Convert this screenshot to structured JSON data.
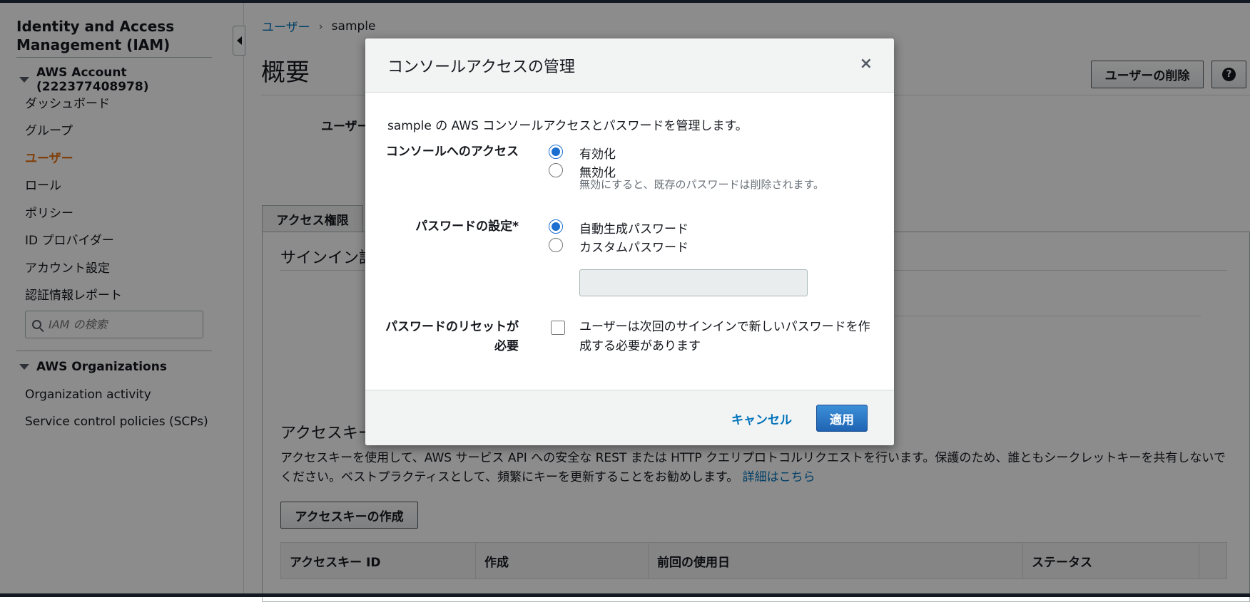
{
  "sidebar": {
    "title": "Identity and Access Management (IAM)",
    "account_section": "AWS Account (222377408978)",
    "items": [
      "ダッシュボード",
      "グループ",
      "ユーザー",
      "ロール",
      "ポリシー",
      "ID プロバイダー",
      "アカウント設定",
      "認証情報レポート"
    ],
    "active_item": "ユーザー",
    "search_placeholder": "IAM の検索",
    "org_section": "AWS Organizations",
    "org_items": [
      "Organization activity",
      "Service control policies (SCPs)"
    ]
  },
  "breadcrumb": {
    "parent": "ユーザー",
    "current": "sample"
  },
  "page": {
    "title": "概要",
    "delete_user_label": "ユーザーの削除",
    "help_icon": "?",
    "user_label_fragment": "ユーザー",
    "tab_permissions": "アクセス権限",
    "signin_section_fragment": "サインイン認",
    "access_keys_fragment": "アクセスキー",
    "access_keys_description": "アクセスキーを使用して、AWS サービス API への安全な REST または HTTP クエリプロトコルリクエストを行います。保護のため、誰ともシークレットキーを共有しないでください。ベストプラクティスとして、頻繁にキーを更新することをお勧めします。",
    "details_link": "詳細はこちら",
    "create_key_label": "アクセスキーの作成",
    "table_headers": [
      "アクセスキー ID",
      "作成",
      "前回の使用日",
      "ステータス",
      ""
    ]
  },
  "modal": {
    "title": "コンソールアクセスの管理",
    "close_icon": "×",
    "intro": "sample の AWS コンソールアクセスとパスワードを管理します。",
    "console_access_label": "コンソールへのアクセス",
    "enable_label": "有効化",
    "disable_label": "無効化",
    "disable_hint": "無効にすると、既存のパスワードは削除されます。",
    "console_access_selected": "enable",
    "password_label": "パスワードの設定*",
    "auto_password_label": "自動生成パスワード",
    "custom_password_label": "カスタムパスワード",
    "password_selected": "auto",
    "custom_password_value": "",
    "reset_label_line1": "パスワードのリセットが",
    "reset_label_line2": "必要",
    "reset_checked": false,
    "reset_description": "ユーザーは次回のサインインで新しいパスワードを作成する必要があります",
    "cancel_label": "キャンセル",
    "apply_label": "適用"
  },
  "colors": {
    "link": "#0073bb",
    "active_nav": "#ec7211",
    "primary_button": "#1f64b4",
    "topbar": "#232f3e"
  }
}
